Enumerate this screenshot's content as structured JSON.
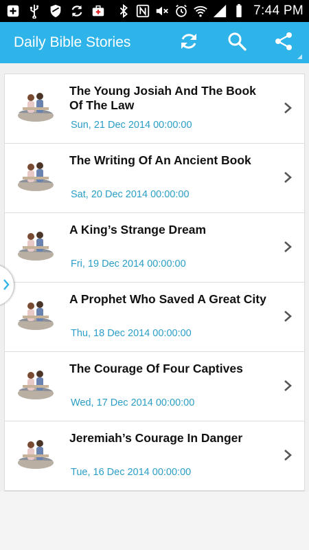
{
  "status_bar": {
    "time": "7:44 PM",
    "icons_left": [
      "add-icon",
      "usb-icon",
      "shield-icon",
      "sync-icon",
      "medical-bag-icon"
    ],
    "icons_right": [
      "bluetooth-icon",
      "nfc-icon",
      "mute-icon",
      "alarm-icon",
      "wifi-icon",
      "signal-icon",
      "battery-icon"
    ]
  },
  "action_bar": {
    "title": "Daily Bible Stories",
    "color": "#2fb4ea",
    "actions": [
      "refresh-icon",
      "search-icon",
      "share-icon"
    ]
  },
  "stories": [
    {
      "title": "The Young Josiah And The Book Of The Law",
      "date": "Sun, 21 Dec 2014 00:00:00"
    },
    {
      "title": "The Writing Of An Ancient Book",
      "date": "Sat, 20 Dec 2014 00:00:00"
    },
    {
      "title": "A King’s Strange Dream",
      "date": "Fri, 19 Dec 2014 00:00:00"
    },
    {
      "title": "A Prophet Who Saved A Great City",
      "date": "Thu, 18 Dec 2014 00:00:00"
    },
    {
      "title": "The Courage Of Four Captives",
      "date": "Wed, 17 Dec 2014 00:00:00"
    },
    {
      "title": "Jeremiah’s Courage In Danger",
      "date": "Tue, 16 Dec 2014 00:00:00"
    }
  ],
  "colors": {
    "date_text": "#2a9ec6",
    "accent": "#2fb4ea"
  }
}
